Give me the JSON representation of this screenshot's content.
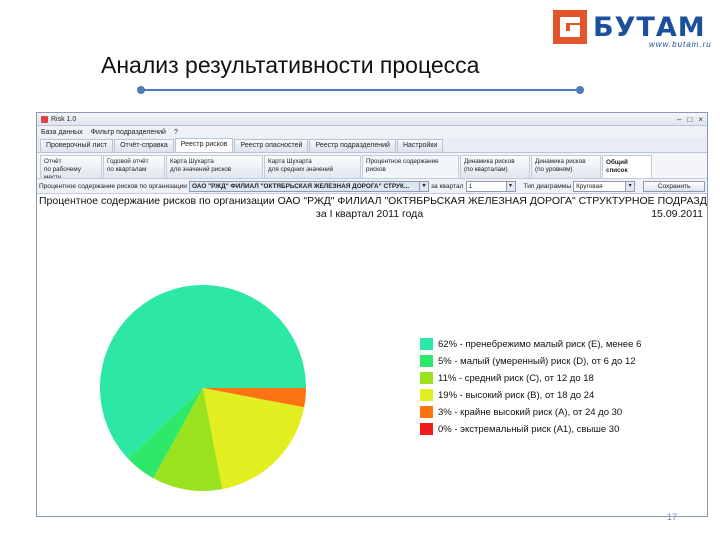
{
  "logo": {
    "brand": "БУТАМ",
    "url": "www.butam.ru",
    "colors": {
      "mark": "#e2552a",
      "text": "#1c4f9c"
    }
  },
  "slide": {
    "title": "Анализ результативности процесса",
    "page_number": "17"
  },
  "window": {
    "title": "Risk 1.0",
    "menu": [
      "База данных",
      "Фильтр подразделений",
      "?"
    ],
    "tabs": [
      {
        "label": "Проверочный лист",
        "active": false
      },
      {
        "label": "Отчёт-справка",
        "active": false
      },
      {
        "label": "Реестр рисков",
        "active": true
      },
      {
        "label": "Реестр опасностей",
        "active": false
      },
      {
        "label": "Реестр подразделений",
        "active": false
      },
      {
        "label": "Настройки",
        "active": false
      }
    ],
    "subtabs": [
      {
        "line1": "Отчёт",
        "line2": "по рабочему месту"
      },
      {
        "line1": "Годовой отчёт",
        "line2": "по кварталам"
      },
      {
        "line1": "Карта Шухарта",
        "line2": "для значений рисков"
      },
      {
        "line1": "Карта Шухарта",
        "line2": "для средних значений"
      },
      {
        "line1": "Процентное содержание",
        "line2": "рисков"
      },
      {
        "line1": "Динамика рисков",
        "line2": "(по кварталам)"
      },
      {
        "line1": "Динамика рисков",
        "line2": "(по уровням)"
      },
      {
        "line1": "Общий список",
        "line2": ""
      }
    ],
    "filter": {
      "label": "Процентное содержание рисков по организации",
      "organization": "ОАО \"РЖД\" ФИЛИАЛ \"ОКТЯБРЬСКАЯ ЖЕЛЕЗНАЯ ДОРОГА\" СТРУК...",
      "quarter_label": "за квартал",
      "quarter_value": "1",
      "chart_type_label": "Тип диаграммы",
      "chart_type_value": "Круговая",
      "save_label": "Сохранить"
    },
    "report": {
      "line1": "Процентное содержание рисков по организации  ОАО \"РЖД\" ФИЛИАЛ \"ОКТЯБРЬСКАЯ ЖЕЛЕЗНАЯ ДОРОГА\"  СТРУКТУРНОЕ ПОДРАЗД",
      "period": "за I квартал 2011 года",
      "date": "15.09.2011"
    }
  },
  "chart_data": {
    "type": "pie",
    "title": "",
    "slices": [
      {
        "label": "62% - пренебрежимо малый риск (E), менее 6",
        "value": 62,
        "color": "#2de8a4"
      },
      {
        "label": "5% - малый (умеренный) риск (D), от 6 до 12",
        "value": 5,
        "color": "#2ee86a"
      },
      {
        "label": "11% - средний риск (C), от 12 до 18",
        "value": 11,
        "color": "#99e21d"
      },
      {
        "label": "19% - высокий риск (B), от 18 до 24",
        "value": 19,
        "color": "#e3ee20"
      },
      {
        "label": "3% - крайне высокий риск (A), от 24 до 30",
        "value": 3,
        "color": "#fb7411"
      },
      {
        "label": "0% - экстремальный риск (A1), свыше 30",
        "value": 0,
        "color": "#f01c1c"
      }
    ],
    "legend_position": "right"
  }
}
